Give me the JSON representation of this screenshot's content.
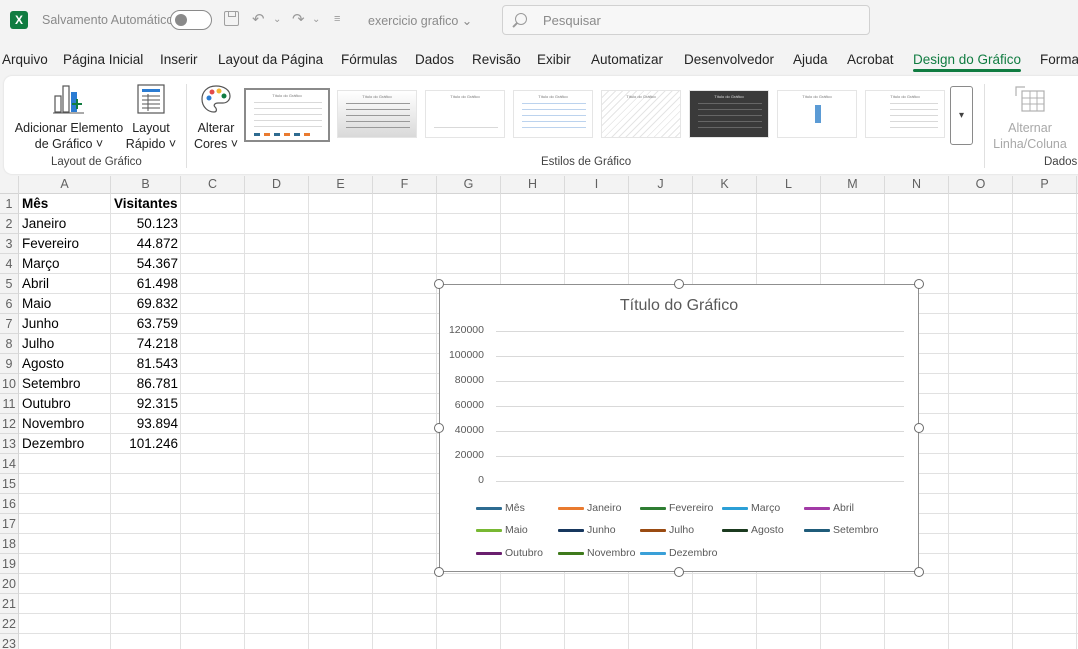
{
  "titlebar": {
    "app_icon": "excel-icon",
    "autosave_label": "Salvamento Automático",
    "filename": "exercicio grafico",
    "search_placeholder": "Pesquisar"
  },
  "tabs": [
    {
      "label": "Arquivo"
    },
    {
      "label": "Página Inicial"
    },
    {
      "label": "Inserir"
    },
    {
      "label": "Layout da Página"
    },
    {
      "label": "Fórmulas"
    },
    {
      "label": "Dados"
    },
    {
      "label": "Revisão"
    },
    {
      "label": "Exibir"
    },
    {
      "label": "Automatizar"
    },
    {
      "label": "Desenvolvedor"
    },
    {
      "label": "Ajuda"
    },
    {
      "label": "Acrobat"
    },
    {
      "label": "Design do Gráfico"
    },
    {
      "label": "Formatar"
    }
  ],
  "active_tab": "Design do Gráfico",
  "ribbon": {
    "add_element": {
      "line1": "Adicionar Elemento",
      "line2": "de Gráfico ˅"
    },
    "quick_layout": {
      "line1": "Layout",
      "line2": "Rápido ˅"
    },
    "change_colors": {
      "line1": "Alterar",
      "line2": "Cores ˅"
    },
    "switch_row_col": {
      "line1": "Alternar",
      "line2": "Linha/Coluna"
    },
    "group_layout": "Layout de Gráfico",
    "group_styles": "Estilos de Gráfico",
    "group_data": "Dados",
    "style_thumb_title": "Título do Gráfico"
  },
  "sheet": {
    "columns": [
      "A",
      "B",
      "C",
      "D",
      "E",
      "F",
      "G",
      "H",
      "I",
      "J",
      "K",
      "L",
      "M",
      "N",
      "O",
      "P"
    ],
    "rows": [
      "1",
      "2",
      "3",
      "4",
      "5",
      "6",
      "7",
      "8",
      "9",
      "10",
      "11",
      "12",
      "13",
      "14",
      "15",
      "16",
      "17",
      "18",
      "19",
      "20",
      "21",
      "22",
      "23"
    ],
    "header": {
      "col_a": "Mês",
      "col_b": "Visitantes"
    },
    "data": [
      {
        "month": "Janeiro",
        "visitors": "50.123"
      },
      {
        "month": "Fevereiro",
        "visitors": "44.872"
      },
      {
        "month": "Março",
        "visitors": "54.367"
      },
      {
        "month": "Abril",
        "visitors": "61.498"
      },
      {
        "month": "Maio",
        "visitors": "69.832"
      },
      {
        "month": "Junho",
        "visitors": "63.759"
      },
      {
        "month": "Julho",
        "visitors": "74.218"
      },
      {
        "month": "Agosto",
        "visitors": "81.543"
      },
      {
        "month": "Setembro",
        "visitors": "86.781"
      },
      {
        "month": "Outubro",
        "visitors": "92.315"
      },
      {
        "month": "Novembro",
        "visitors": "93.894"
      },
      {
        "month": "Dezembro",
        "visitors": "101.246"
      }
    ]
  },
  "chart_data": {
    "type": "line",
    "title": "Título do Gráfico",
    "y_ticks": [
      "120000",
      "100000",
      "80000",
      "60000",
      "40000",
      "20000",
      "0"
    ],
    "ylim": [
      0,
      120000
    ],
    "grid": true,
    "legend_position": "bottom",
    "series": [
      {
        "name": "Mês",
        "color": "#2d6b91"
      },
      {
        "name": "Janeiro",
        "color": "#e97a2f"
      },
      {
        "name": "Fevereiro",
        "color": "#2e7d32"
      },
      {
        "name": "Março",
        "color": "#2b9fd6"
      },
      {
        "name": "Abril",
        "color": "#a23aa6"
      },
      {
        "name": "Maio",
        "color": "#78b833"
      },
      {
        "name": "Junho",
        "color": "#17375e"
      },
      {
        "name": "Julho",
        "color": "#9a4b12"
      },
      {
        "name": "Agosto",
        "color": "#1b3a1f"
      },
      {
        "name": "Setembro",
        "color": "#1f5c7a"
      },
      {
        "name": "Outubro",
        "color": "#6a1f6e"
      },
      {
        "name": "Novembro",
        "color": "#3f7a1c"
      },
      {
        "name": "Dezembro",
        "color": "#3aa0d8"
      }
    ]
  }
}
